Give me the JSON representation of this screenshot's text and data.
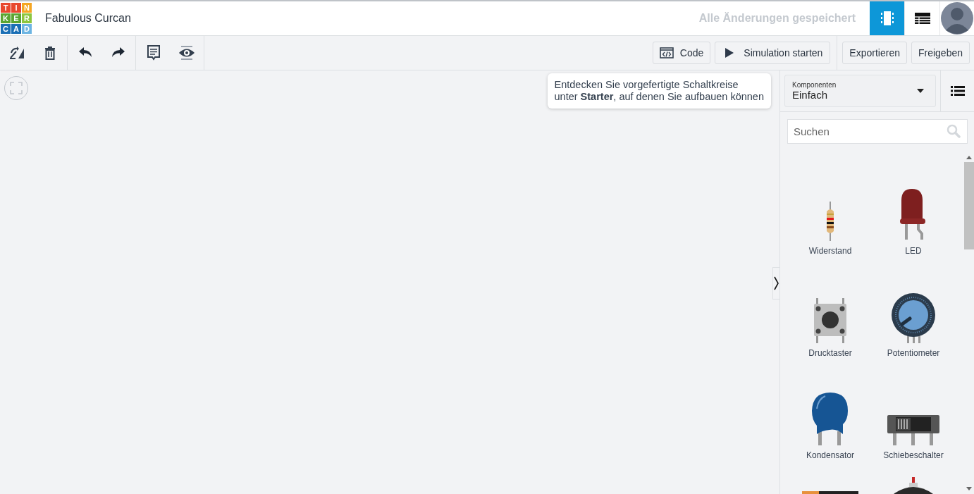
{
  "header": {
    "logo_letters": [
      "T",
      "I",
      "N",
      "K",
      "E",
      "R",
      "C",
      "A",
      "D"
    ],
    "title": "Fabulous Curcan",
    "save_status": "Alle Änderungen gespeichert",
    "views": [
      {
        "kind": "circuit",
        "selected": true
      },
      {
        "kind": "schematic",
        "selected": false
      }
    ]
  },
  "toolbar": {
    "tools": [
      {
        "kind": "rotate"
      },
      {
        "kind": "delete"
      },
      {
        "kind": "undo"
      },
      {
        "kind": "redo"
      },
      {
        "kind": "notes"
      },
      {
        "kind": "visibility"
      }
    ],
    "code_button": "Code",
    "simulate_button": "Simulation starten",
    "export_button": "Exportieren",
    "share_button": "Freigeben"
  },
  "tooltip": {
    "text": "Entdecken Sie vorgefertigte Schaltkreise\nunter **Starter**, auf denen Sie aufbauen können"
  },
  "panel": {
    "dropdown_label": "Komponenten",
    "dropdown_value": "Einfach",
    "search": {
      "placeholder": "Suchen"
    },
    "components": [
      {
        "kind": "resistor",
        "name": "Widerstand"
      },
      {
        "kind": "led",
        "name": "LED"
      },
      {
        "kind": "pushbutton",
        "name": "Drucktaster"
      },
      {
        "kind": "potentiometer",
        "name": "Potentiometer"
      },
      {
        "kind": "capacitor",
        "name": "Kondensator"
      },
      {
        "kind": "slideswitch",
        "name": "Schiebeschalter"
      },
      {
        "kind": "battery"
      },
      {
        "kind": "knob"
      }
    ]
  }
}
